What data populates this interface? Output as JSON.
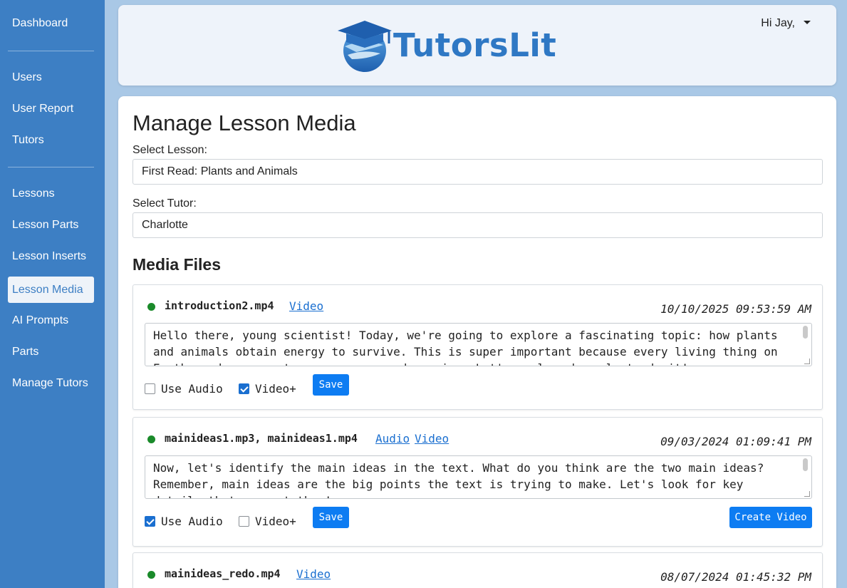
{
  "sidebar": {
    "items": [
      {
        "label": "Dashboard"
      },
      {
        "label": "Users"
      },
      {
        "label": "User Report"
      },
      {
        "label": "Tutors"
      },
      {
        "label": "Lessons"
      },
      {
        "label": "Lesson Parts"
      },
      {
        "label": "Lesson Inserts"
      },
      {
        "label": "Lesson Media",
        "active": true
      },
      {
        "label": "AI Prompts"
      },
      {
        "label": "Parts"
      },
      {
        "label": "Manage Tutors"
      }
    ]
  },
  "header": {
    "logo_text": "TutorsLit",
    "greeting": "Hi Jay,"
  },
  "main": {
    "title": "Manage Lesson Media",
    "lesson_label": "Select Lesson:",
    "lesson_value": "First Read: Plants and Animals",
    "tutor_label": "Select Tutor:",
    "tutor_value": "Charlotte",
    "media_title": "Media Files",
    "media": [
      {
        "filename": "introduction2.mp4",
        "links": [
          "Video"
        ],
        "timestamp": "10/10/2025 09:53:59 AM",
        "text": "Hello there, young scientist! Today, we're going to explore a fascinating topic: how plants and animals obtain energy to survive. This is super important because every living thing on Earth needs energy to grow, move, and survive. Let's explore how plants do it!",
        "use_audio_label": "Use Audio",
        "use_audio": false,
        "video_plus_label": "Video+",
        "video_plus": true,
        "save_label": "Save"
      },
      {
        "filename": "mainideas1.mp3, mainideas1.mp4",
        "links": [
          "Audio",
          "Video"
        ],
        "timestamp": "09/03/2024 01:09:41 PM",
        "text": "Now, let's identify the main ideas in the text. What do you think are the two main ideas? Remember, main ideas are the big points the text is trying to make. Let's look for key details that support them!",
        "use_audio_label": "Use Audio",
        "use_audio": true,
        "video_plus_label": "Video+",
        "video_plus": false,
        "save_label": "Save",
        "create_video_label": "Create Video"
      },
      {
        "filename": "mainideas_redo.mp4",
        "links": [
          "Video"
        ],
        "timestamp": "08/07/2024 01:45:32 PM"
      }
    ]
  },
  "colors": {
    "sidebar_bg": "#3d7fc4",
    "accent": "#0d7cf2",
    "status_dot": "#1a8a2a"
  }
}
